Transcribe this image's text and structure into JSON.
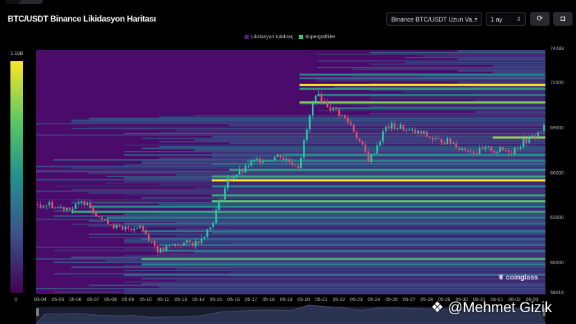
{
  "header": {
    "title": "BTC/USDT Binance Likidasyon Haritası",
    "pair_select": "Binance BTC/USDT Uzun Va...",
    "range_select": "1 ay",
    "refresh_icon": "refresh-icon",
    "camera_icon": "camera-icon"
  },
  "watermark": "coinglass",
  "signature": "@Mehmet Gizik",
  "chart_data": {
    "type": "heatmap",
    "title": "BTC/USDT Binance Likidasyon Haritası",
    "legend": [
      {
        "label": "Likidasyon Kaldıraç",
        "color": "#5b1a7a"
      },
      {
        "label": "Süpergrafikler",
        "color": "#2ecc71"
      }
    ],
    "colorbar": {
      "min_label": "0",
      "max_label": "1.18B"
    },
    "y_ticks": [
      "74283",
      "72000",
      "69000",
      "66000",
      "63000",
      "60000",
      "58016"
    ],
    "y_tick_values": [
      74283,
      72000,
      69000,
      66000,
      63000,
      60000,
      58016
    ],
    "ylim": [
      58016,
      74283
    ],
    "x": [
      "05-04",
      "05-05",
      "05-06",
      "05-07",
      "05-08",
      "05-09",
      "05-10",
      "05-11",
      "05-13",
      "05-14",
      "05-15",
      "05-16",
      "05-17",
      "05-18",
      "05-19",
      "05-20",
      "05-21",
      "05-22",
      "05-23",
      "05-24",
      "05-26",
      "05-27",
      "05-28",
      "05-29",
      "05-30",
      "05-31",
      "06-01",
      "06-02",
      "06-03"
    ],
    "price_close": [
      64000,
      63800,
      64300,
      62800,
      62200,
      62600,
      61000,
      61300,
      61400,
      62500,
      65600,
      66300,
      67100,
      67300,
      66600,
      71500,
      70300,
      69300,
      67000,
      69100,
      69100,
      68700,
      68200,
      68000,
      67600,
      67700,
      67600,
      68300,
      69100
    ],
    "levels": [
      {
        "price": 72650,
        "intensity": 0.45,
        "start": 15
      },
      {
        "price": 72400,
        "intensity": 0.3,
        "start": 15
      },
      {
        "price": 71950,
        "intensity": 1.0,
        "start": 15
      },
      {
        "price": 71700,
        "intensity": 0.55,
        "start": 15
      },
      {
        "price": 71300,
        "intensity": 0.4,
        "start": 16
      },
      {
        "price": 70800,
        "intensity": 0.8,
        "start": 15
      },
      {
        "price": 70400,
        "intensity": 0.35,
        "start": 17
      },
      {
        "price": 68450,
        "intensity": 0.85,
        "start": 26
      },
      {
        "price": 67300,
        "intensity": 0.5,
        "start": 14
      },
      {
        "price": 66900,
        "intensity": 0.45,
        "start": 12
      },
      {
        "price": 66700,
        "intensity": 0.35,
        "start": 10
      },
      {
        "price": 66300,
        "intensity": 0.55,
        "start": 11
      },
      {
        "price": 65850,
        "intensity": 0.6,
        "start": 10
      },
      {
        "price": 65600,
        "intensity": 1.0,
        "start": 10
      },
      {
        "price": 65200,
        "intensity": 0.45,
        "start": 10
      },
      {
        "price": 64600,
        "intensity": 0.6,
        "start": 10
      },
      {
        "price": 64200,
        "intensity": 0.75,
        "start": 10
      },
      {
        "price": 63850,
        "intensity": 0.5,
        "start": 3
      },
      {
        "price": 63500,
        "intensity": 0.6,
        "start": 2
      },
      {
        "price": 63100,
        "intensity": 0.4,
        "start": 4
      },
      {
        "price": 62700,
        "intensity": 0.35,
        "start": 5
      },
      {
        "price": 62200,
        "intensity": 0.4,
        "start": 6
      },
      {
        "price": 61700,
        "intensity": 0.3,
        "start": 6
      },
      {
        "price": 61300,
        "intensity": 0.35,
        "start": 7
      },
      {
        "price": 60900,
        "intensity": 0.4,
        "start": 7
      },
      {
        "price": 60350,
        "intensity": 0.65,
        "start": 6
      },
      {
        "price": 60000,
        "intensity": 0.45,
        "start": 6
      },
      {
        "price": 59300,
        "intensity": 0.35,
        "start": 5
      },
      {
        "price": 58700,
        "intensity": 0.2,
        "start": 6
      }
    ]
  }
}
